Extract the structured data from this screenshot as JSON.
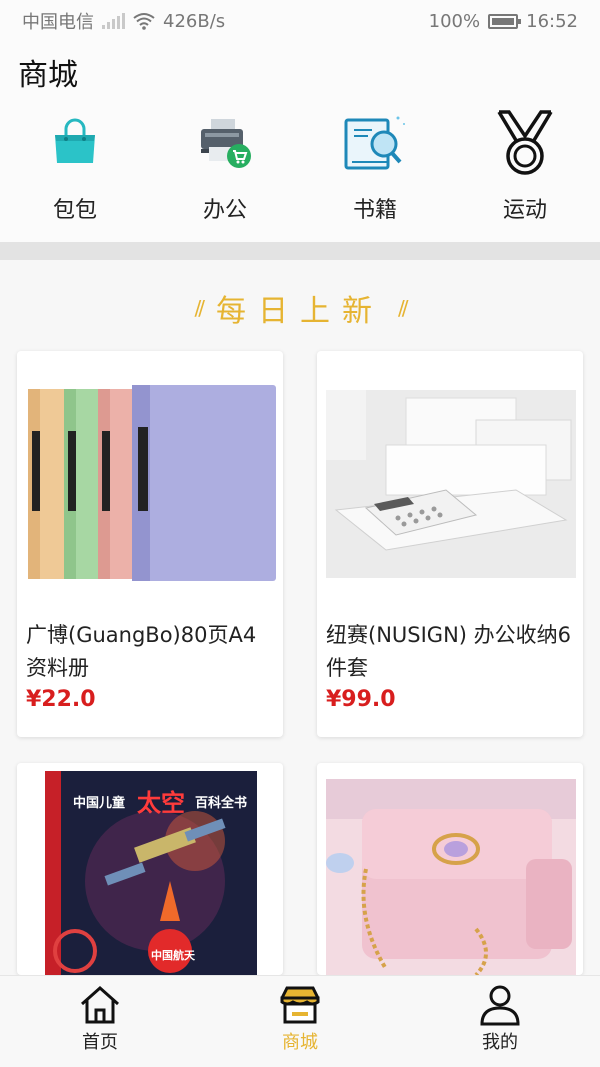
{
  "status_bar": {
    "carrier": "中国电信",
    "network_speed": "426B/s",
    "battery": "100%",
    "time": "16:52"
  },
  "header": {
    "title": "商城"
  },
  "categories": [
    {
      "label": "包包",
      "icon": "handbag-icon"
    },
    {
      "label": "办公",
      "icon": "printer-cart-icon"
    },
    {
      "label": "书籍",
      "icon": "book-magnifier-icon"
    },
    {
      "label": "运动",
      "icon": "medal-icon"
    }
  ],
  "section": {
    "title": "每日上新"
  },
  "products": [
    {
      "name": "广博(GuangBo)80页A4资料册",
      "price": "¥22.0"
    },
    {
      "name": "纽赛(NUSIGN) 办公收纳6件套",
      "price": "¥99.0"
    },
    {
      "name": "",
      "price": "",
      "image_text": {
        "title_a": "中国儿童",
        "title_b": "太空",
        "title_c": "百科全书",
        "badge": "中国航天"
      }
    },
    {
      "name": "",
      "price": ""
    }
  ],
  "tabbar": {
    "tabs": [
      {
        "label": "首页",
        "icon": "home-icon",
        "active": false
      },
      {
        "label": "商城",
        "icon": "store-icon",
        "active": true
      },
      {
        "label": "我的",
        "icon": "person-icon",
        "active": false
      }
    ]
  },
  "colors": {
    "accent": "#e6b432",
    "price": "#d81e1e"
  }
}
